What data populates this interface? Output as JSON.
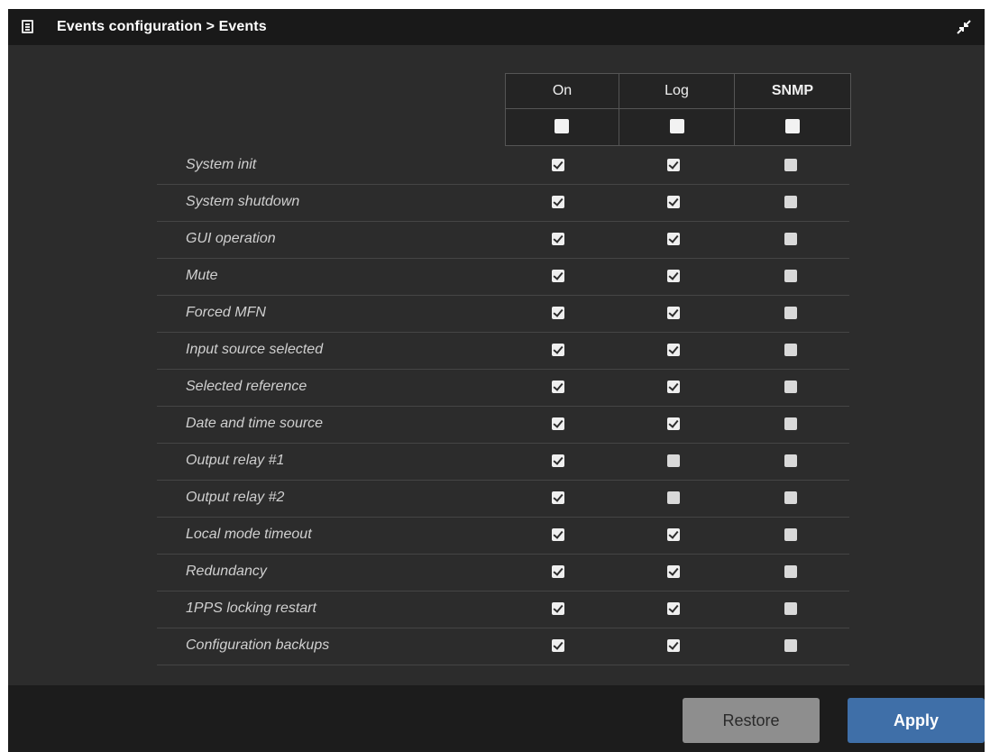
{
  "window": {
    "title": "Events configuration > Events",
    "icon": "list-icon",
    "collapse_icon": "collapse-arrows-icon"
  },
  "columns": [
    "On",
    "Log",
    "SNMP"
  ],
  "master": [
    false,
    false,
    false
  ],
  "events": [
    {
      "label": "System init",
      "on": true,
      "log": true,
      "snmp": false
    },
    {
      "label": "System shutdown",
      "on": true,
      "log": true,
      "snmp": false
    },
    {
      "label": "GUI operation",
      "on": true,
      "log": true,
      "snmp": false
    },
    {
      "label": "Mute",
      "on": true,
      "log": true,
      "snmp": false
    },
    {
      "label": "Forced MFN",
      "on": true,
      "log": true,
      "snmp": false
    },
    {
      "label": "Input source selected",
      "on": true,
      "log": true,
      "snmp": false
    },
    {
      "label": "Selected reference",
      "on": true,
      "log": true,
      "snmp": false
    },
    {
      "label": "Date and time source",
      "on": true,
      "log": true,
      "snmp": false
    },
    {
      "label": "Output relay #1",
      "on": true,
      "log": false,
      "snmp": false
    },
    {
      "label": "Output relay #2",
      "on": true,
      "log": false,
      "snmp": false
    },
    {
      "label": "Local mode timeout",
      "on": true,
      "log": true,
      "snmp": false
    },
    {
      "label": "Redundancy",
      "on": true,
      "log": true,
      "snmp": false
    },
    {
      "label": "1PPS locking restart",
      "on": true,
      "log": true,
      "snmp": false
    },
    {
      "label": "Configuration backups",
      "on": true,
      "log": true,
      "snmp": false
    }
  ],
  "footer": {
    "restore_label": "Restore",
    "apply_label": "Apply"
  },
  "colors": {
    "panel_bg": "#2c2c2c",
    "titlebar_bg": "#191919",
    "apply_bg": "#3f6fa8",
    "restore_bg": "#8e8e8e"
  }
}
